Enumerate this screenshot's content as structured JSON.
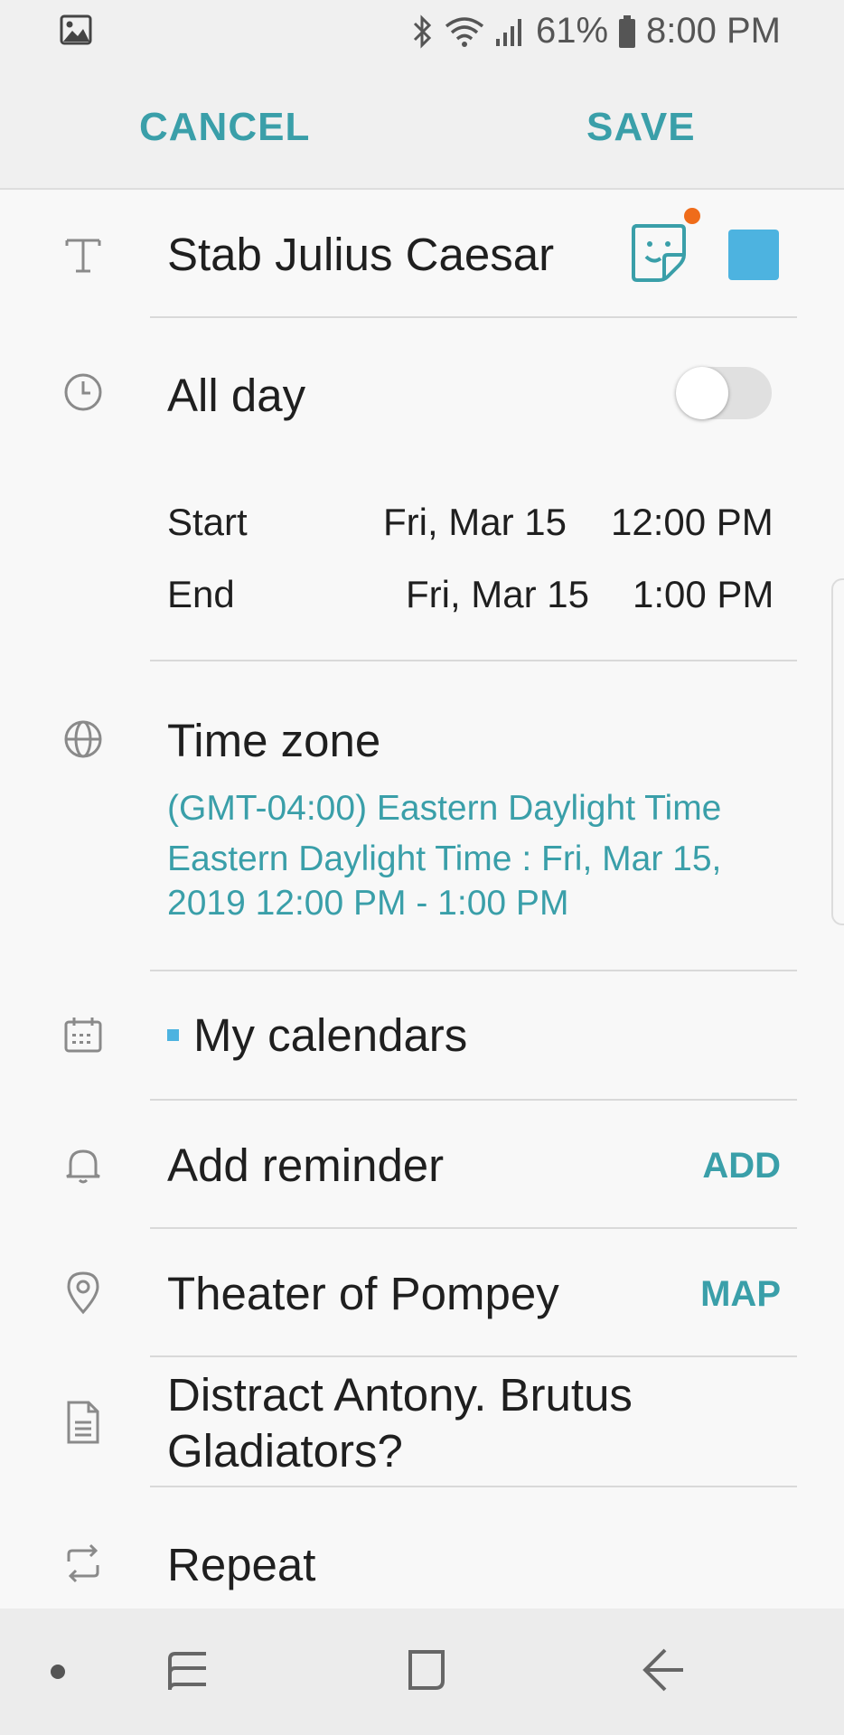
{
  "status_bar": {
    "battery": "61%",
    "time": "8:00 PM",
    "icons": [
      "gallery-icon",
      "bluetooth-icon",
      "wifi-icon",
      "signal-icon",
      "battery-icon"
    ]
  },
  "toolbar": {
    "cancel_label": "CANCEL",
    "save_label": "SAVE",
    "accent_color": "#3a9fa9"
  },
  "event": {
    "title": "Stab Julius Caesar",
    "color": "#4db3e0",
    "all_day_label": "All day",
    "all_day_on": false,
    "start_label": "Start",
    "start_date": "Fri, Mar 15",
    "start_time": "12:00 PM",
    "end_label": "End",
    "end_date": "Fri, Mar 15",
    "end_time": "1:00 PM",
    "timezone_label": "Time zone",
    "timezone_value": "(GMT-04:00) Eastern Daylight Time",
    "timezone_detail_line1": "Eastern Daylight Time : Fri, Mar 15,",
    "timezone_detail_line2": "2019 12:00 PM - 1:00 PM",
    "calendar": "My calendars",
    "reminder_label": "Add reminder",
    "reminder_action": "ADD",
    "location": "Theater of Pompey",
    "location_action": "MAP",
    "notes_line1": "Distract Antony.  Brutus",
    "notes_line2": "Gladiators?",
    "repeat_label": "Repeat"
  },
  "nav_bar": {
    "icons": [
      "dot-icon",
      "recent-apps-icon",
      "home-icon",
      "back-icon"
    ]
  }
}
